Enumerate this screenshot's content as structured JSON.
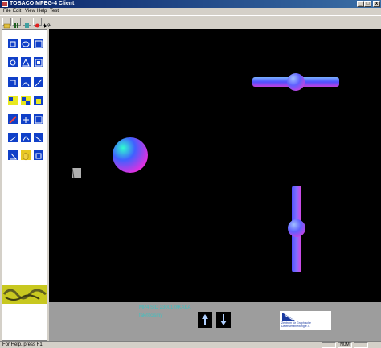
{
  "window": {
    "title": "TOBACO MPEG-4 Client",
    "controls": {
      "minimize": "_",
      "maximize": "□",
      "close": "x"
    }
  },
  "menu": [
    "File",
    "Edit",
    "View",
    "Help",
    "Test"
  ],
  "toolbar": {
    "buttons": [
      {
        "icon": "open-folder-icon"
      },
      {
        "icon": "pause-icon"
      },
      {
        "icon": "stop-icon"
      },
      {
        "icon": "record-icon"
      },
      {
        "icon": "help-cursor-icon"
      }
    ]
  },
  "palette": {
    "tools": [
      "shape-tool-1",
      "shape-tool-2",
      "shape-tool-3",
      "shape-tool-4",
      "shape-tool-5",
      "shape-tool-6",
      "shape-tool-7",
      "shape-tool-8",
      "shape-tool-9",
      "yellow-tool-1",
      "yellow-tool-2",
      "yellow-tool-3",
      "pencil-tool",
      "grid-tool-1",
      "grid-tool-2",
      "line-tool-1",
      "line-tool-2",
      "line-tool-3",
      "angle-tool",
      "cube-tool",
      "box-tool"
    ]
  },
  "bottom": {
    "stream_text": "MP4 SID 23001@KAKA",
    "user_text": "fak@cismy",
    "org_logo_text": "Zentrum für Graphische Datenverarbeitung e.V."
  },
  "statusbar": {
    "help_text": "For Help, press F1",
    "num": "NUM"
  },
  "colors": {
    "accent_title": "#0a246a",
    "viewport": "#000000",
    "tool_blue": "#1040c8",
    "teal_text": "#40c0c0"
  }
}
